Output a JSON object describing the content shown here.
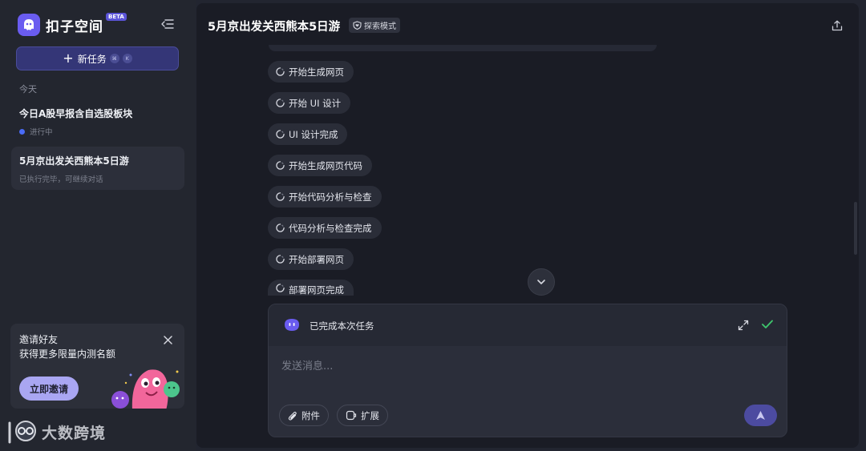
{
  "sidebar": {
    "brand_name": "扣子空间",
    "beta_label": "BETA",
    "new_task": {
      "label": "新任务",
      "shortcut_keys": [
        "⌘",
        "K"
      ]
    },
    "section_today": "今天",
    "tasks": [
      {
        "title": "今日A股早报含自选股板块",
        "status": "进行中"
      },
      {
        "title": "5月京出发关西熊本5日游",
        "status": "已执行完毕，可继续对话"
      }
    ],
    "invite": {
      "title": "邀请好友",
      "subtitle": "获得更多限量内测名额",
      "button": "立即邀请"
    },
    "watermark": "大数跨境"
  },
  "main": {
    "title": "5月京出发关西熊本5日游",
    "mode_badge": "探索模式",
    "steps": [
      "开始生成网页",
      "开始 UI 设计",
      "UI 设计完成",
      "开始生成网页代码",
      "开始代码分析与检查",
      "代码分析与检查完成",
      "开始部署网页",
      "部署网页完成"
    ],
    "composer": {
      "status_text": "已完成本次任务",
      "placeholder": "发送消息...",
      "attach_label": "附件",
      "extend_label": "扩展"
    }
  },
  "colors": {
    "accent": "#6a5cf0",
    "success": "#3ec46d",
    "background": "#222530",
    "panel": "#1a1c25"
  },
  "icons": {
    "collapse": "collapse-sidebar-icon",
    "share": "share-upload-icon",
    "scroll_down": "chevron-down-icon",
    "expand": "expand-icon",
    "check": "check-icon",
    "attach": "paperclip-icon",
    "extend": "extension-icon",
    "send": "send-arrow-icon"
  }
}
